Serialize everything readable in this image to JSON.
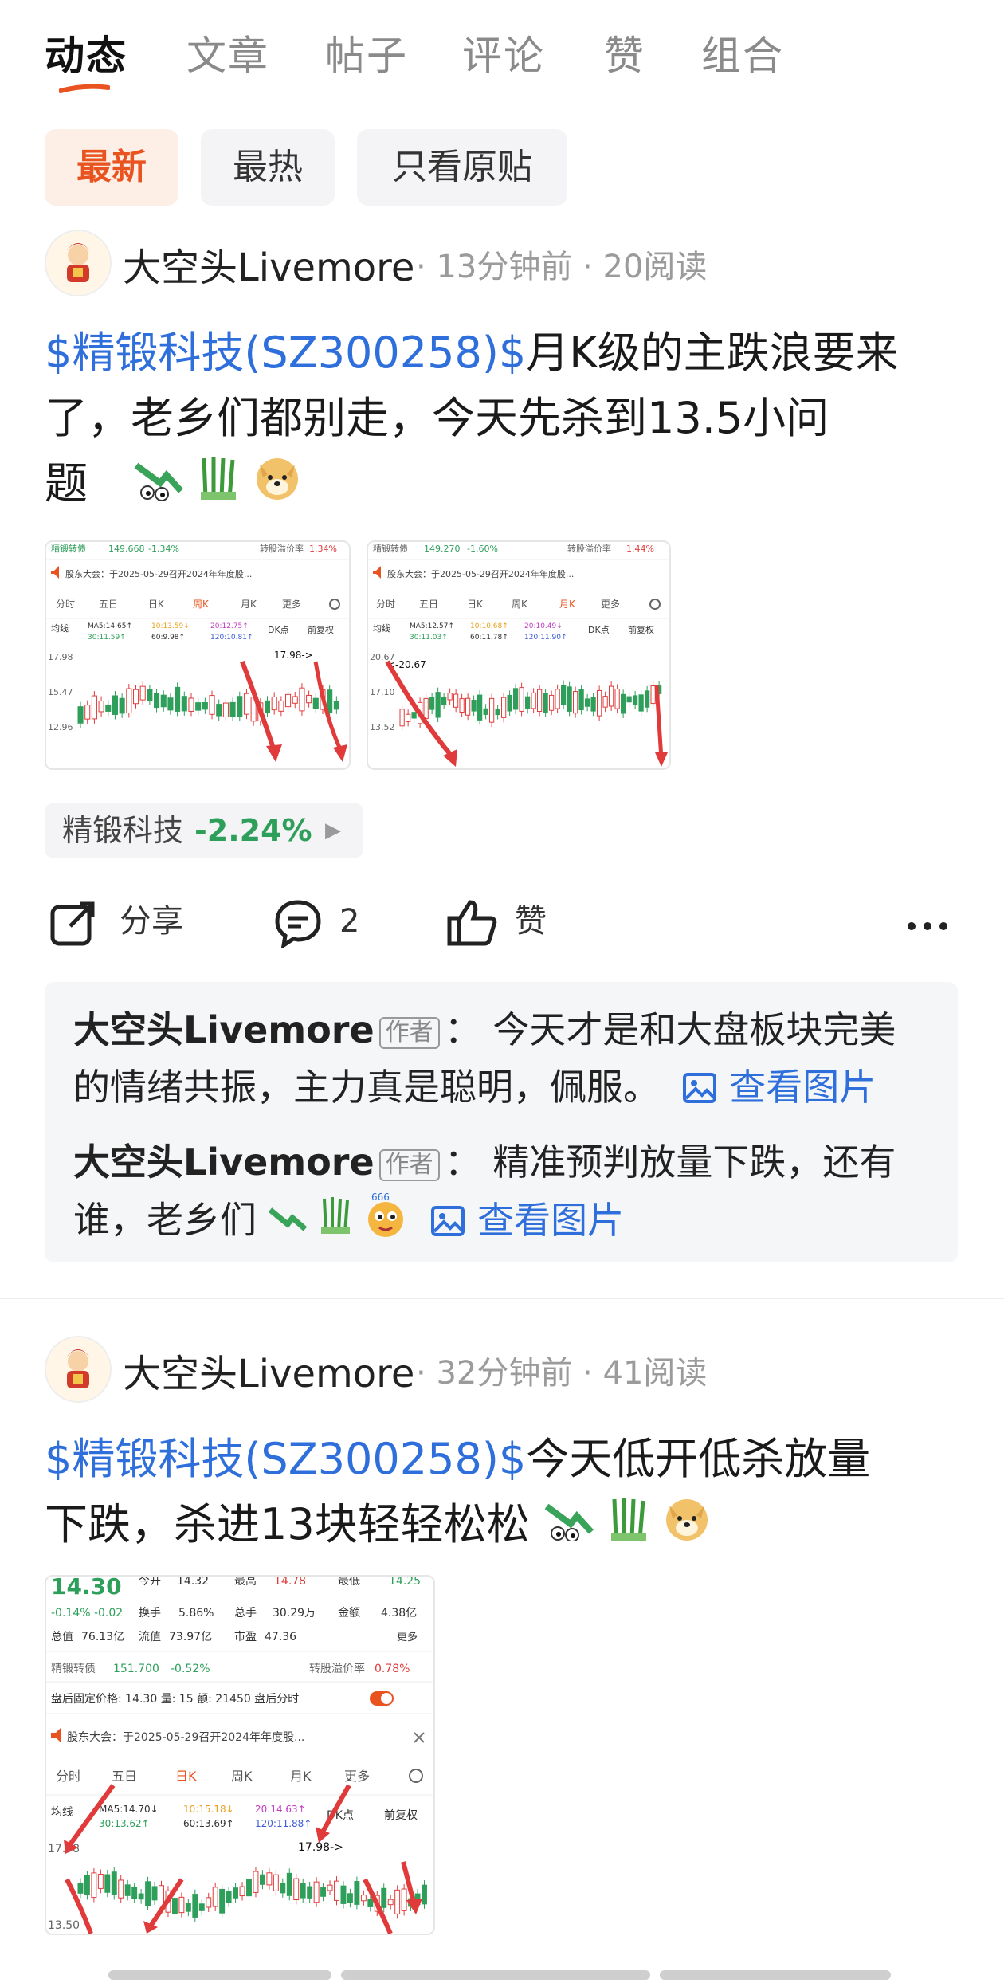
{
  "tabs": [
    "动态",
    "文章",
    "帖子",
    "评论",
    "赞",
    "组合"
  ],
  "filters": [
    "最新",
    "最热",
    "只看原贴"
  ],
  "post1": {
    "author": "大空头Livemore",
    "time": "13分钟前",
    "reads": "20阅读",
    "stock_link": "$精锻科技(SZ300258)$",
    "text_a": "月K级的主跌浪要来",
    "text_b": "了，老乡们都别走，今天先杀到13.5小问",
    "text_c": "题",
    "chart1": {
      "header_name": "精锻转债",
      "header_price": "149.668",
      "header_pct": "-1.34%",
      "header_right": "转股溢价率",
      "header_right_val": "1.34%",
      "notice": "股东大会：于2025-05-29召开2024年年度股...",
      "periods": [
        "分时",
        "五日",
        "日K",
        "周K",
        "月K",
        "更多"
      ],
      "active_period": "周K",
      "ma_label": "均线",
      "ma": [
        "MA5:14.65↑",
        "10:13.59↓",
        "20:12.75↑",
        "30:11.59↑",
        "60:9.98↑",
        "120:10.81↑"
      ],
      "dk": "DK点",
      "rights": "前复权",
      "y_ticks": [
        "17.98",
        "15.47",
        "12.96"
      ],
      "high_label": "17.98->"
    },
    "chart2": {
      "header_name": "精锻转债",
      "header_price": "149.270",
      "header_pct": "-1.60%",
      "header_right": "转股溢价率",
      "header_right_val": "1.44%",
      "notice": "股东大会：于2025-05-29召开2024年年度股...",
      "periods": [
        "分时",
        "五日",
        "日K",
        "周K",
        "月K",
        "更多"
      ],
      "active_period": "月K",
      "ma_label": "均线",
      "ma": [
        "MA5:12.57↑",
        "10:10.68↑",
        "20:10.49↓",
        "30:11.03↑",
        "60:11.78↑",
        "120:11.90↑"
      ],
      "dk": "DK点",
      "rights": "前复权",
      "y_ticks": [
        "20.67",
        "17.10",
        "13.52"
      ],
      "high_label": "<-20.67"
    },
    "stock_tag": {
      "name": "精锻科技",
      "pct": "-2.24%"
    },
    "actions": {
      "share": "分享",
      "comments": "2",
      "like": "赞"
    },
    "comments": [
      {
        "author": "大空头Livemore",
        "badge": "作者",
        "sep": "：",
        "line1": "今天才是和大盘板块完美",
        "line2": "的情绪共振，主力真是聪明，佩服。",
        "view": "查看图片"
      },
      {
        "author": "大空头Livemore",
        "badge": "作者",
        "sep": "：",
        "line1": "精准预判放量下跌，还有",
        "line2": "谁，老乡们",
        "view": "查看图片"
      }
    ]
  },
  "post2": {
    "author": "大空头Livemore",
    "time": "32分钟前",
    "reads": "41阅读",
    "stock_link": "$精锻科技(SZ300258)$",
    "text_a": "今天低开低杀放量",
    "text_b": "下跌，杀进13块轻轻松松",
    "chart": {
      "price": "14.30",
      "chg": "-0.14%  -0.02",
      "q1": [
        "今开",
        "14.32",
        "最高",
        "14.78",
        "最低",
        "14.25"
      ],
      "q2": [
        "换手",
        "5.86%",
        "总手",
        "30.29万",
        "金额",
        "4.38亿"
      ],
      "q3": [
        "总值",
        "76.13亿",
        "流值",
        "73.97亿",
        "市盈",
        "47.36"
      ],
      "more": "更多",
      "bond_name": "精锻转债",
      "bond_price": "151.700",
      "bond_pct": "-0.52%",
      "bond_right": "转股溢价率",
      "bond_right_val": "0.78%",
      "after": "盘后固定价格: 14.30  量: 15  额: 21450  盘后分时",
      "notice": "股东大会：于2025-05-29召开2024年年度股...",
      "periods": [
        "分时",
        "五日",
        "日K",
        "周K",
        "月K",
        "更多"
      ],
      "active_period": "日K",
      "ma_label": "均线",
      "ma": [
        "MA5:14.70↓",
        "10:15.18↓",
        "20:14.63↑",
        "30:13.62↑",
        "60:13.69↑",
        "120:11.88↑"
      ],
      "dk": "DK点",
      "rights": "前复权",
      "y_ticks": [
        "17.98",
        "13.50"
      ],
      "high_label": "17.98->"
    }
  },
  "colors": {
    "accent": "#e8531f",
    "link": "#2f6fdc",
    "down": "#2e9f5a",
    "up": "#e23b3b"
  },
  "icons": [
    "share-icon",
    "comment-icon",
    "like-icon",
    "more-icon",
    "image-icon",
    "speaker-icon",
    "gear-icon",
    "chevron-right-icon"
  ]
}
